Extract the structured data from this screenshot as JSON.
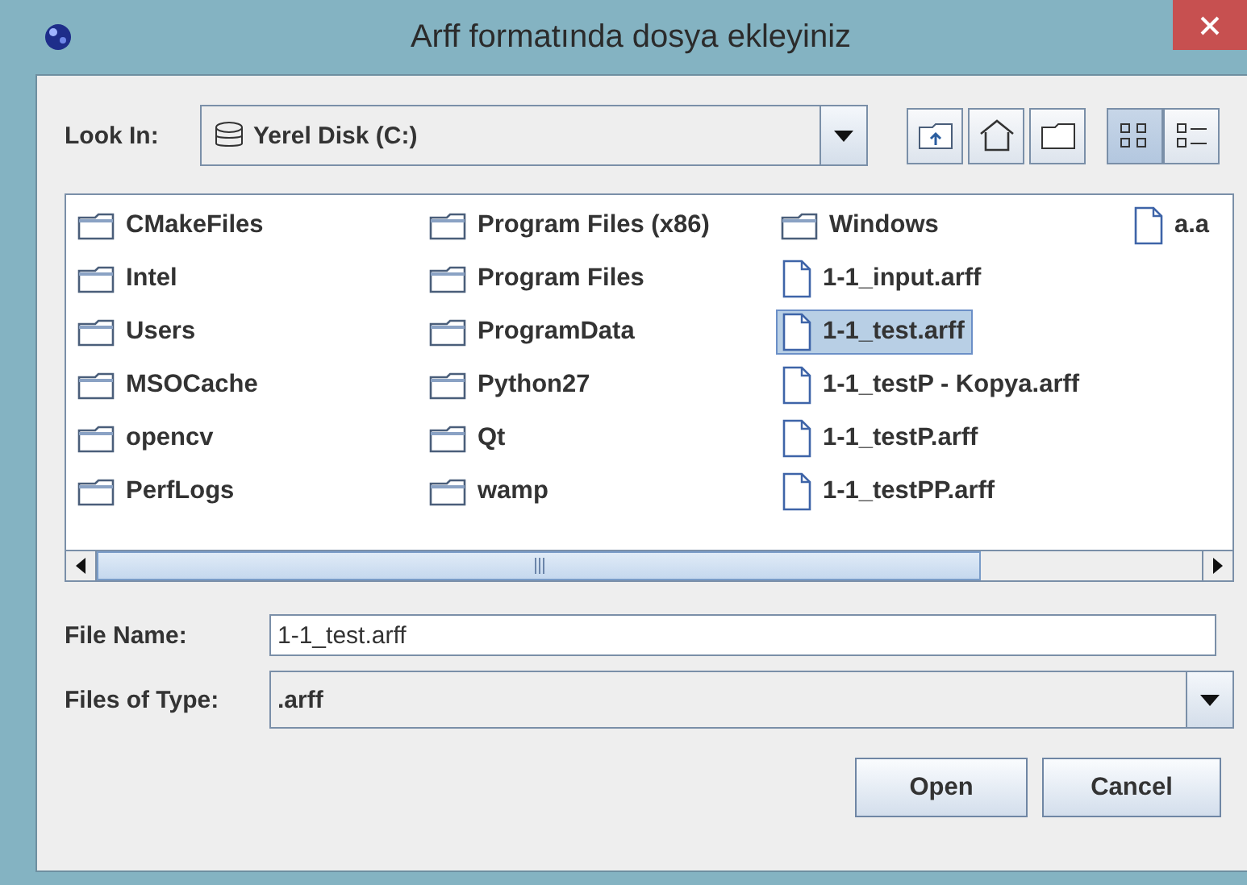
{
  "window": {
    "title": "Arff formatında dosya ekleyiniz"
  },
  "look_in": {
    "label": "Look In:",
    "value": "Yerel Disk (C:)"
  },
  "view_modes": [
    {
      "kind": "list",
      "selected": true
    },
    {
      "kind": "details",
      "selected": false
    }
  ],
  "file_list": {
    "columns": [
      [
        {
          "name": "CMakeFiles",
          "kind": "folder",
          "selected": false
        },
        {
          "name": "Intel",
          "kind": "folder",
          "selected": false
        },
        {
          "name": "Users",
          "kind": "folder",
          "selected": false
        },
        {
          "name": "MSOCache",
          "kind": "folder",
          "selected": false
        },
        {
          "name": "opencv",
          "kind": "folder",
          "selected": false
        },
        {
          "name": "PerfLogs",
          "kind": "folder",
          "selected": false
        }
      ],
      [
        {
          "name": "Program Files (x86)",
          "kind": "folder",
          "selected": false
        },
        {
          "name": "Program Files",
          "kind": "folder",
          "selected": false
        },
        {
          "name": "ProgramData",
          "kind": "folder",
          "selected": false
        },
        {
          "name": "Python27",
          "kind": "folder",
          "selected": false
        },
        {
          "name": "Qt",
          "kind": "folder",
          "selected": false
        },
        {
          "name": "wamp",
          "kind": "folder",
          "selected": false
        }
      ],
      [
        {
          "name": "Windows",
          "kind": "folder",
          "selected": false
        },
        {
          "name": "1-1_input.arff",
          "kind": "file",
          "selected": false
        },
        {
          "name": "1-1_test.arff",
          "kind": "file",
          "selected": true
        },
        {
          "name": "1-1_testP - Kopya.arff",
          "kind": "file",
          "selected": false
        },
        {
          "name": "1-1_testP.arff",
          "kind": "file",
          "selected": false
        },
        {
          "name": "1-1_testPP.arff",
          "kind": "file",
          "selected": false
        }
      ],
      [
        {
          "name": "a.a",
          "kind": "file",
          "selected": false
        }
      ]
    ]
  },
  "file_name": {
    "label": "File Name:",
    "value": "1-1_test.arff"
  },
  "file_type": {
    "label": "Files of Type:",
    "value": ".arff"
  },
  "buttons": [
    {
      "label": "Open"
    },
    {
      "label": "Cancel"
    }
  ]
}
